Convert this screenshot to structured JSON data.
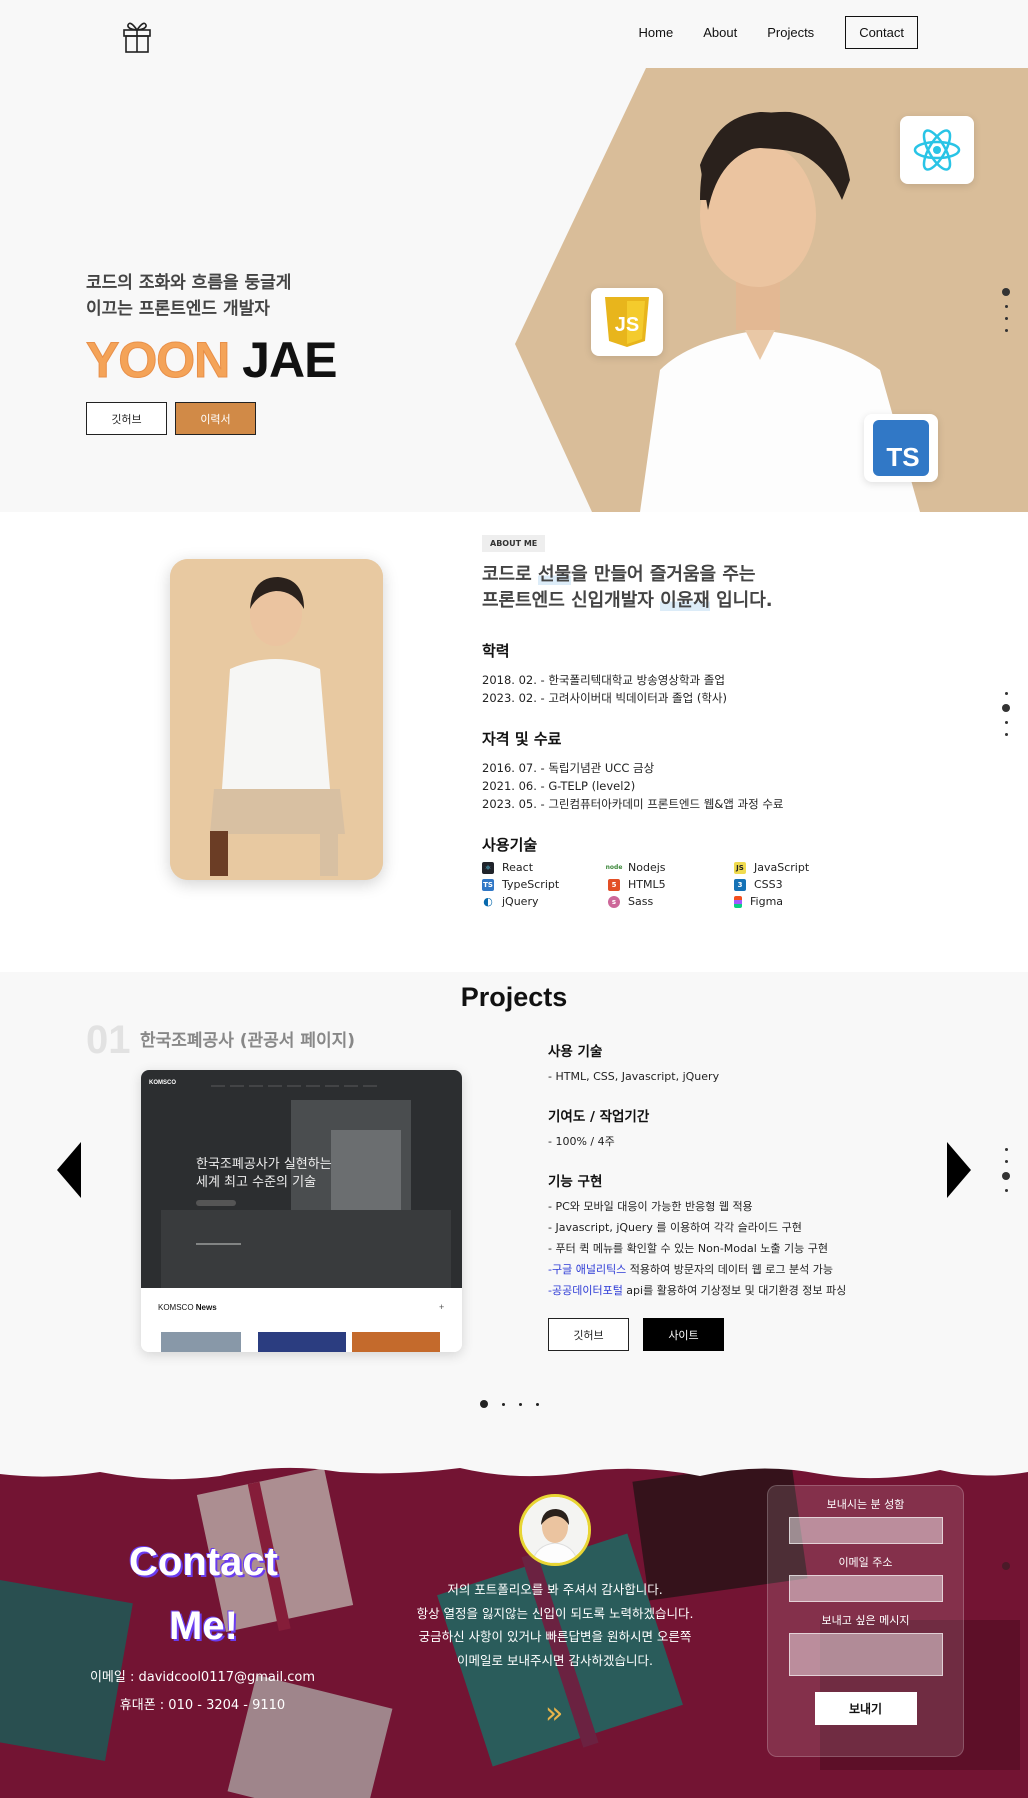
{
  "nav": {
    "items": [
      "Home",
      "About",
      "Projects"
    ],
    "contact": "Contact"
  },
  "hero": {
    "tagline_1": "코드의 조화와 흐름을 둥글게",
    "tagline_2": "이끄는 프론트엔드 개발자",
    "name_first": "YOON",
    "name_last": "JAE",
    "btn_github": "깃허브",
    "btn_resume": "이력서",
    "icon_js": "JS",
    "icon_ts": "TS"
  },
  "about": {
    "tag": "ABOUT ME",
    "title_1_a": "코드로 ",
    "title_1_hl": "선물",
    "title_1_b": "을 만들어 즐거움을 주는",
    "title_2_a": "프론트엔드 신입개발자 ",
    "title_2_hl": "이윤재",
    "title_2_b": " 입니다.",
    "education_title": "학력",
    "education": [
      "2018. 02. - 한국폴리텍대학교 방송영상학과 졸업",
      "2023. 02. - 고려사이버대 빅데이터과 졸업 (학사)"
    ],
    "cert_title": "자격 및 수료",
    "certs": [
      "2016. 07. - 독립기념관 UCC 금상",
      "2021. 06. - G-TELP (level2)",
      "2023. 05. - 그린컴퓨터아카데미 프론트엔드 웹&앱 과정 수료"
    ],
    "skills_title": "사용기술",
    "skills": [
      "React",
      "Nodejs",
      "JavaScript",
      "TypeScript",
      "HTML5",
      "CSS3",
      "jQuery",
      "Sass",
      "Figma"
    ]
  },
  "projects": {
    "title": "Projects",
    "num": "01",
    "name": "한국조폐공사 (관공서 페이지)",
    "tech_title": "사용 기술",
    "tech": "- HTML, CSS, Javascript, jQuery",
    "contrib_title": "기여도 / 작업기간",
    "contrib": "- 100% / 4주",
    "feature_title": "기능 구현",
    "features": [
      "- PC와 모바일 대응이 가능한 반응형 웹 적용",
      "- Javascript, jQuery 를 이용하여 각각 슬라이드 구현",
      "- 푸터 퀵 메뉴를 확인할 수 있는 Non-Modal 노출 기능 구현"
    ],
    "feature_4_link": "-구글 애널리틱스",
    "feature_4_rest": " 적용하여 방문자의 데이터 웹 로그 분석 가능",
    "feature_5_link": "-공공데이터포털",
    "feature_5_rest": " api를 활용하여 기상정보 및 대기환경 정보 파싱",
    "btn_github": "깃허브",
    "btn_site": "사이트",
    "shot": {
      "brand": "KOMSCO",
      "headline_1": "한국조폐공사가 실현하는",
      "headline_2": "세계 최고 수준의 기술",
      "news_a": "KOMSCO ",
      "news_b": "News",
      "plus": "+"
    }
  },
  "contact": {
    "title_1": "Contact",
    "title_2": "Me!",
    "email": "이메일 : davidcool0117@gmail.com",
    "phone": "휴대폰 : 010 - 3204 - 9110",
    "msg": [
      "저의 포트폴리오를 봐 주셔서 감사합니다.",
      "항상 열정을 잃지않는 신입이 되도록 노력하겠습니다.",
      "궁금하신 사항이 있거나 빠른답변을 원하시면 오른쪽",
      "이메일로 보내주시면 감사하겠습니다."
    ],
    "arrow": "»",
    "form_name": "보내시는 분 성함",
    "form_email": "이메일 주소",
    "form_msg": "보내고 싶은 메시지",
    "form_send": "보내기"
  }
}
